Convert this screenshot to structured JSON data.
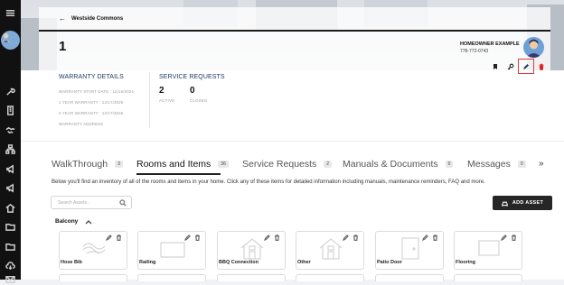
{
  "sidebar": {
    "icons": [
      "menu-icon",
      "avatar",
      "wrench-icon",
      "building-icon",
      "handshake-icon",
      "organization-icon",
      "megaphone-icon",
      "megaphone-icon",
      "home-icon",
      "folder-icon",
      "folder-icon",
      "cloud-download-icon",
      "mail-icon"
    ]
  },
  "header": {
    "back_label": "Westside Commons",
    "title": "1",
    "owner_name": "HOMEOWNER EXAMPLE",
    "owner_phone": "778-772-0743"
  },
  "warranty": {
    "heading": "WARRANTY DETAILS",
    "start": "WARRANTY START DATE : 12/16/2024",
    "one_year": "1 YEAR WARRANTY : 12/17/2025",
    "two_year": "2 YEAR WARRANTY : 12/17/2026",
    "address": "WARRANTY ADDRESS"
  },
  "service_requests": {
    "heading": "SERVICE REQUESTS",
    "active_count": "2",
    "active_label": "ACTIVE",
    "closed_count": "0",
    "closed_label": "CLOSED"
  },
  "tabs": [
    {
      "label": "WalkThrough",
      "count": "3"
    },
    {
      "label": "Rooms and Items",
      "count": "36"
    },
    {
      "label": "Service Requests",
      "count": "2"
    },
    {
      "label": "Manuals & Documents",
      "count": "0"
    },
    {
      "label": "Messages",
      "count": "0"
    }
  ],
  "more_label": "»",
  "info_text": "Below you'll find an inventory of all of the rooms and items in your home. Click any of these items for detailed information including manuals, maintenance reminders, FAQ and more.",
  "search": {
    "placeholder": "Search Assets..."
  },
  "add_asset_label": "ADD ASSET",
  "group": {
    "name": "Balcony"
  },
  "assets": [
    {
      "name": "Hose Bib",
      "icon": "hose-icon"
    },
    {
      "name": "Railing",
      "icon": "railing-icon"
    },
    {
      "name": "BBQ Connection",
      "icon": "house-icon"
    },
    {
      "name": "Other",
      "icon": "house-icon"
    },
    {
      "name": "Patio Door",
      "icon": "door-icon"
    },
    {
      "name": "Flooring",
      "icon": "flooring-icon"
    }
  ],
  "colors": {
    "accent_navy": "#1f3b63",
    "highlight_red": "#e23b3b",
    "delete_red": "#e02020",
    "dark_button": "#262626"
  }
}
